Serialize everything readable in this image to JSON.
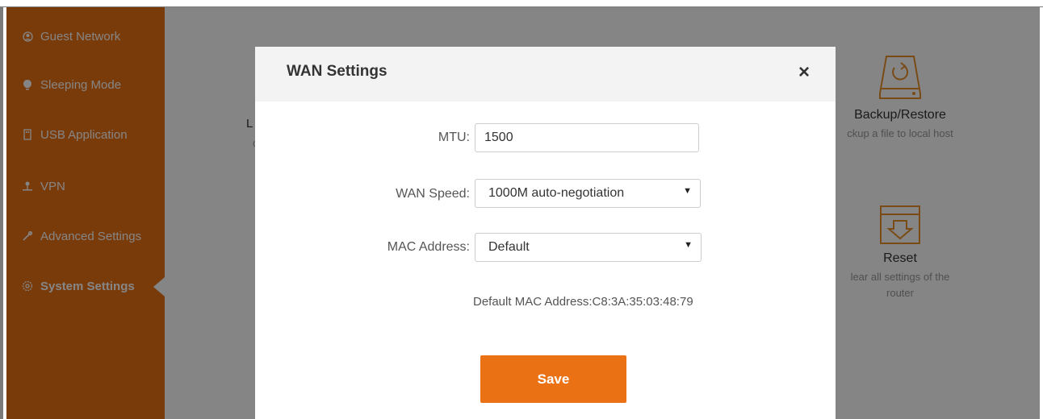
{
  "sidebar": {
    "items": [
      {
        "label": "Guest Network"
      },
      {
        "label": "Sleeping Mode"
      },
      {
        "label": "USB Application"
      },
      {
        "label": "VPN"
      },
      {
        "label": "Advanced Settings"
      },
      {
        "label": "System Settings"
      }
    ],
    "active_index": 5
  },
  "main": {
    "left_fragment": "L",
    "left_fragment2": "c",
    "tiles": [
      {
        "title": "Backup/Restore",
        "desc": "ckup a file to local host"
      },
      {
        "title": "Reset",
        "desc_line1": "lear all settings of the",
        "desc_line2": "router"
      }
    ]
  },
  "modal": {
    "title": "WAN Settings",
    "close_label": "×",
    "mtu_label": "MTU:",
    "mtu_value": "1500",
    "wan_speed_label": "WAN Speed:",
    "wan_speed_value": "1000M auto-negotiation",
    "mac_label": "MAC Address:",
    "mac_value": "Default",
    "default_mac_text": "Default MAC Address:C8:3A:35:03:48:79",
    "save_label": "Save"
  },
  "colors": {
    "accent": "#ea7114",
    "overlay": "rgba(0,0,0,0.48)"
  },
  "icons": [
    "guest-network-icon",
    "sleeping-mode-icon",
    "usb-icon",
    "vpn-icon",
    "wrench-icon",
    "gear-icon",
    "backup-icon",
    "reset-icon",
    "close-icon",
    "caret-down-icon"
  ]
}
